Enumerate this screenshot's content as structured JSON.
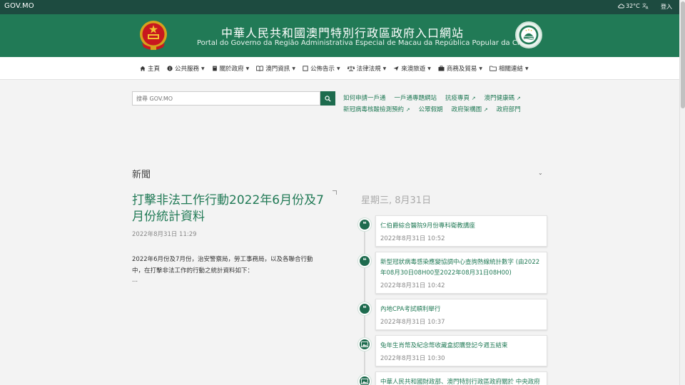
{
  "topbar": {
    "brand": "GOV.MO",
    "temperature": "32°C",
    "language_icon": "translate-icon",
    "login": "登入"
  },
  "header": {
    "title_zh": "中華人民共和國澳門特別行政區政府入口網站",
    "title_pt": "Portal do Governo da Região Administrativa Especial de Macau da República Popular da China"
  },
  "nav": {
    "items": [
      {
        "label": "主頁",
        "icon": "home-icon"
      },
      {
        "label": "公共服務",
        "icon": "info-icon"
      },
      {
        "label": "關於政府",
        "icon": "book-icon"
      },
      {
        "label": "澳門資訊",
        "icon": "open-book-icon"
      },
      {
        "label": "公佈告示",
        "icon": "notice-icon"
      },
      {
        "label": "法律法規",
        "icon": "scale-icon"
      },
      {
        "label": "來澳旅遊",
        "icon": "plane-icon"
      },
      {
        "label": "商務及貿易",
        "icon": "briefcase-icon"
      },
      {
        "label": "相關連結",
        "icon": "folder-icon"
      }
    ]
  },
  "search": {
    "placeholder": "搜尋 GOV.MO"
  },
  "quicklinks": {
    "row1": [
      "如何申請一戶通",
      "一戶通專題網站",
      "抗疫專頁",
      "澳門健康碼"
    ],
    "row2": [
      "新冠病毒核酸檢測預約",
      "公眾假期",
      "政府架構圖",
      "政府部門"
    ]
  },
  "news": {
    "section_title": "新聞",
    "feature": {
      "title": "打擊非法工作行動2022年6月份及7月份統計資料",
      "date": "2022年8月31日 11:29",
      "body": "2022年6月份及7月份，治安警察局，勞工事務局，以及各聯合行動中，在打擊非法工作的行動之統計資料如下：",
      "more": "..."
    },
    "timeline_date": "星期三, 8月31日",
    "timeline": [
      {
        "title": "仁伯爵綜合醫院9月份專科衛教講座",
        "date": "2022年8月31日 10:52",
        "icon": "quote-icon"
      },
      {
        "title": "新型冠狀病毒感染應變協調中心查詢熱線統計數字 (由2022年08月30日08H00至2022年08月31日08H00)",
        "date": "2022年8月31日 10:42",
        "icon": "quote-icon"
      },
      {
        "title": "內地CPA考試順利舉行",
        "date": "2022年8月31日 10:37",
        "icon": "quote-icon"
      },
      {
        "title": "兔年生肖幣及紀念幣收藏盒認購登記今週五結束",
        "date": "2022年8月31日 10:30",
        "icon": "image-icon"
      },
      {
        "title": "中華人民共和國財政部、澳門特別行政區政府關於 中央政府",
        "date": "",
        "icon": "image-icon"
      }
    ]
  },
  "colors": {
    "topbar": "#1d4b40",
    "header": "#217a56",
    "accent": "#1d6b4e"
  }
}
